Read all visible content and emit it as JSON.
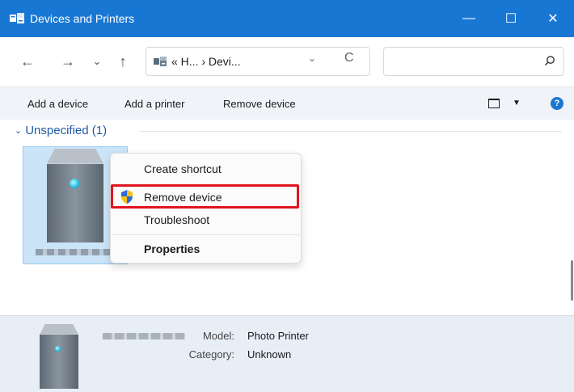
{
  "window": {
    "title": "Devices and Printers",
    "minimize_glyph": "—",
    "maximize_glyph": "☐",
    "close_glyph": "✕",
    "title_bar_color": "#1977d4"
  },
  "nav": {
    "back_glyph": "←",
    "forward_glyph": "→",
    "recent_glyph": "⌄",
    "up_glyph": "↑",
    "address_text": "« H... › Devi...",
    "address_dropdown_glyph": "⌄",
    "refresh_glyph": "C",
    "search_placeholder": ""
  },
  "commands": {
    "add_device": "Add a device",
    "add_printer": "Add a printer",
    "remove_device": "Remove device",
    "view_dropdown_glyph": "▼",
    "help_glyph": "?"
  },
  "group": {
    "chevron_glyph": "⌄",
    "label": "Unspecified (1)"
  },
  "context_menu": {
    "items": [
      {
        "label": "Create shortcut"
      },
      {
        "label": "Remove device",
        "icon": "uac-shield-icon",
        "highlighted": true
      },
      {
        "label": "Troubleshoot"
      },
      {
        "label": "Properties",
        "bold": true
      }
    ],
    "highlight_color": "#e0141e"
  },
  "details": {
    "model_label": "Model:",
    "model_value": "Photo Printer",
    "category_label": "Category:",
    "category_value": "Unknown"
  },
  "colors": {
    "accent": "#1977d4",
    "group_header": "#1e5aa8",
    "selection": "#cce4f7"
  }
}
